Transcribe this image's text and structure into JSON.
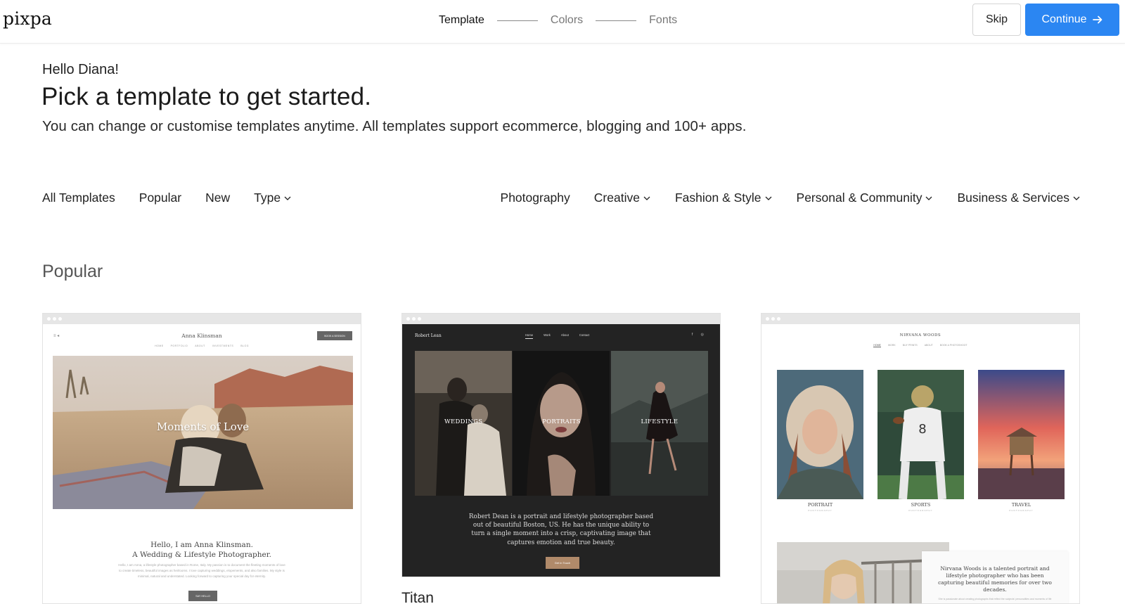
{
  "header": {
    "logo": "pixpa",
    "steps": [
      "Template",
      "Colors",
      "Fonts"
    ],
    "skip_label": "Skip",
    "continue_label": "Continue"
  },
  "intro": {
    "greeting": "Hello Diana!",
    "title": "Pick a template to get started.",
    "subtitle": "You can change or customise templates anytime. All templates support ecommerce, blogging and 100+ apps."
  },
  "filters": {
    "left": [
      "All Templates",
      "Popular",
      "New",
      "Type"
    ],
    "right": [
      "Photography",
      "Creative",
      "Fashion & Style",
      "Personal & Community",
      "Business & Services"
    ]
  },
  "section": {
    "title": "Popular"
  },
  "cards": [
    {
      "site_name": "Anna Klinsman",
      "menu": [
        "HOME",
        "PORTFOLIO",
        "ABOUT",
        "INVESTMENTS",
        "BLOG"
      ],
      "book_label": "BOOK A SESSION",
      "hero_text": "Moments of Love",
      "intro_line1": "Hello, I am Anna Klinsman.",
      "intro_line2": "A Wedding & Lifestyle Photographer.",
      "lorem": "Hello, I am Anna, a lifestyle photographer based in Rome, Italy. My passion is to document the fleeting moments of love to create timeless, beautiful images as heirlooms. I love capturing weddings, elopements, and also families. My style is minimal, natural and understated. Looking forward to capturing your special day for eternity.",
      "button": "SAY HELLO"
    },
    {
      "name": "Titan",
      "site_name": "Robert Lean",
      "menu": [
        "Home",
        "Work",
        "About",
        "Contact"
      ],
      "panels": [
        "WEDDINGS",
        "PORTRAITS",
        "LIFESTYLE"
      ],
      "description": "Robert Dean is a portrait and lifestyle photographer based out of beautiful Boston, US. He has the unique ability to turn a single moment into a crisp, captivating image that captures emotion and true beauty.",
      "button": "Get in Touch"
    },
    {
      "site_name": "NIRVANA WOODS",
      "menu": [
        "HOME",
        "WORK",
        "BUY PRINTS",
        "ABOUT",
        "BOOK A PHOTOSHOOT"
      ],
      "tiles": [
        {
          "title": "PORTRAIT",
          "sub": "PHOTOGRAPHY"
        },
        {
          "title": "SPORTS",
          "sub": "PHOTOGRAPHY"
        },
        {
          "title": "TRAVEL",
          "sub": "PHOTOGRAPHY"
        }
      ],
      "lower_text": "Nirvana Woods is a talented portrait and lifestyle photographer who has been capturing beautiful memories for over two decades.",
      "lower_sub": "She is passionate about creating photographs that reflect the subjects' personalities and moments of life"
    }
  ],
  "colors": {
    "accent": "#2b86f2",
    "titan_bg": "#232323",
    "titan_button": "#b08a6a"
  }
}
